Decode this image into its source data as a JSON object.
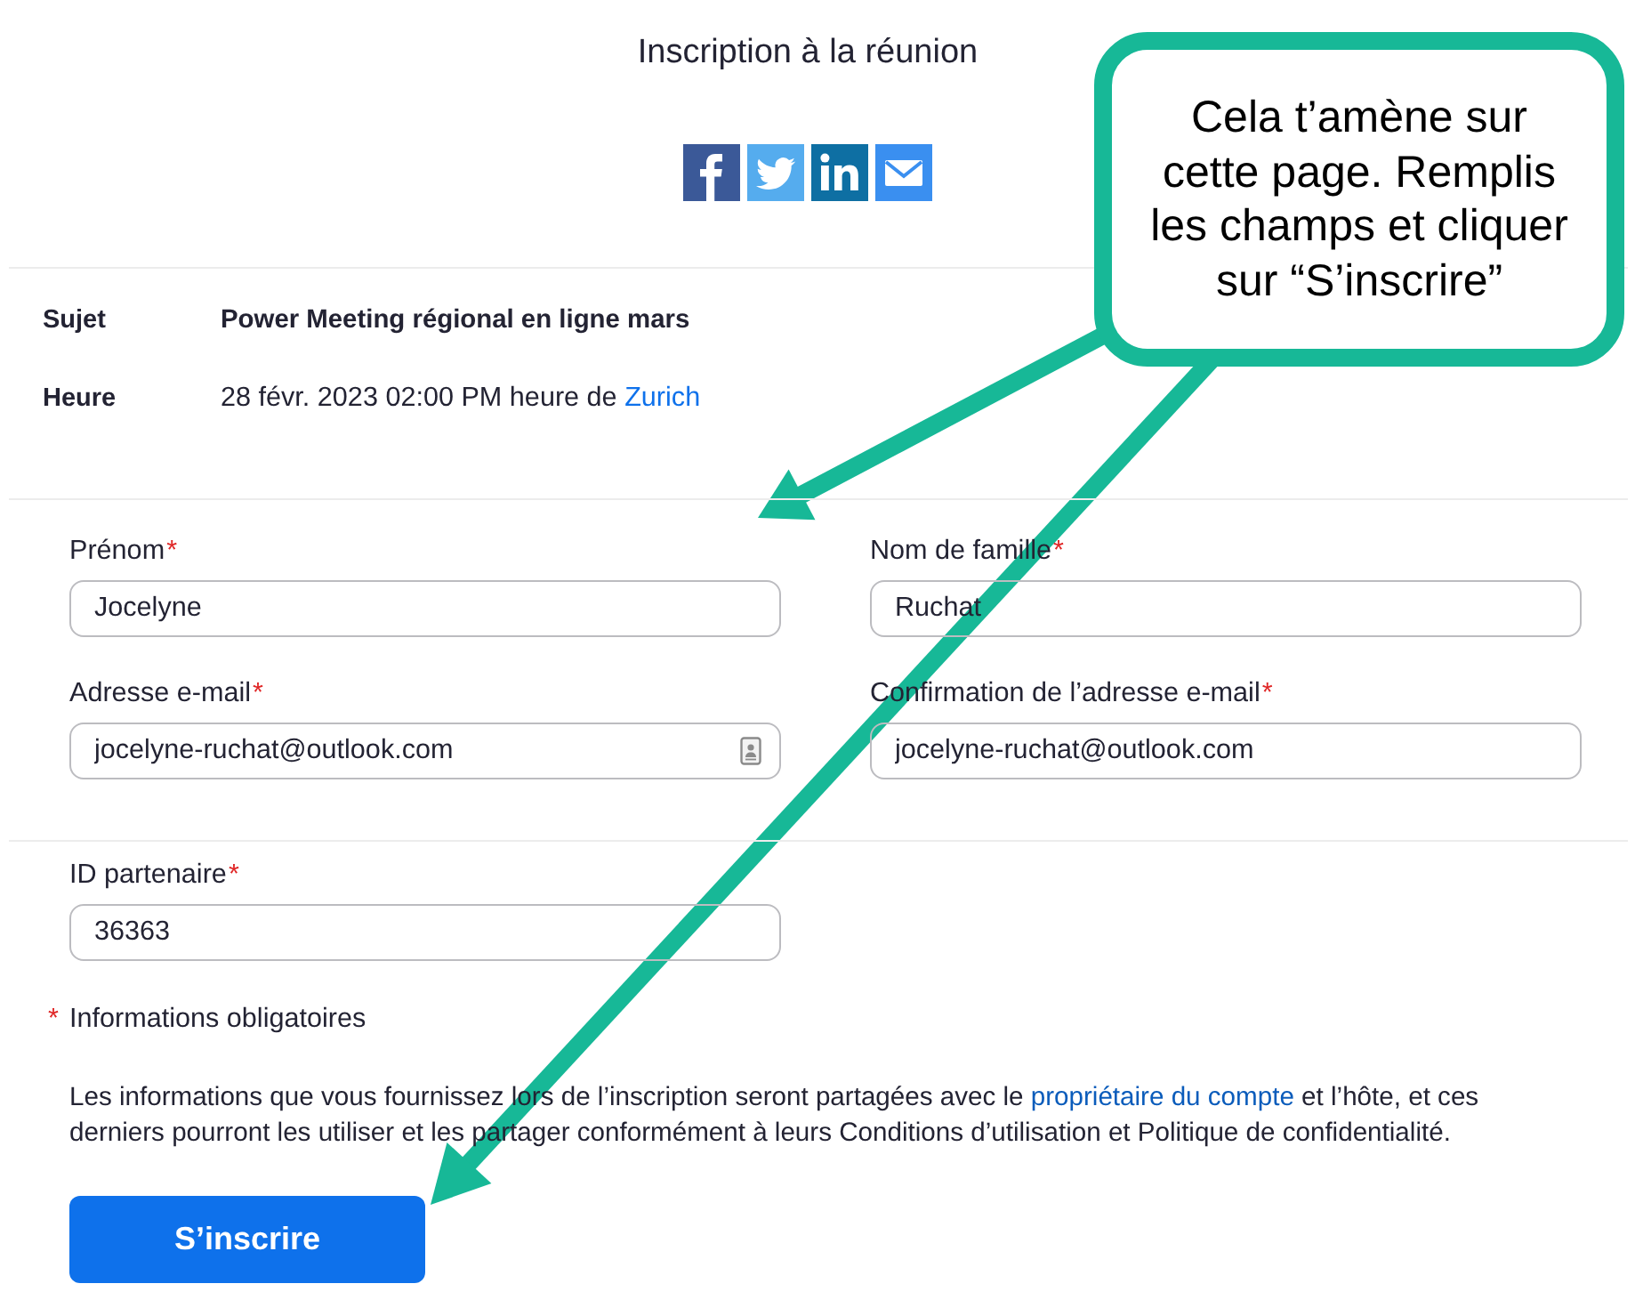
{
  "page": {
    "title": "Inscription à la réunion"
  },
  "meeting_details": [
    {
      "label": "Sujet",
      "value": "Power Meeting régional en ligne mars"
    },
    {
      "label": "Heure",
      "value": "28 févr. 2023 02:00 PM heure de ",
      "link": "Zurich"
    }
  ],
  "form_sections": [
    {
      "fields": [
        {
          "label": "Prénom",
          "mark": "*",
          "value": "Jocelyne",
          "contact_icon": false
        },
        {
          "label": "Nom de famille",
          "mark": "*",
          "value": "Ruchat",
          "contact_icon": false
        },
        {
          "label": "Adresse e-mail",
          "mark": "*",
          "value": "jocelyne-ruchat@outlook.com",
          "contact_icon": true
        },
        {
          "label": "Confirmation de l’adresse e-mail",
          "mark": "*",
          "value": "jocelyne-ruchat@outlook.com",
          "contact_icon": false
        }
      ]
    },
    {
      "fields": [
        {
          "label": "ID partenaire",
          "mark": "*",
          "value": "36363",
          "contact_icon": false
        }
      ]
    }
  ],
  "required_note": {
    "mark": "*",
    "text": "Informations obligatoires"
  },
  "disclaimer": {
    "before": "Les informations que vous fournissez lors de l’inscription seront partagées avec le ",
    "link": "propriétaire du compte",
    "after": " et l’hôte, et ces derniers pourront les utiliser et les partager conformément à leurs Conditions d’utilisation et Politique de confidentialité."
  },
  "submit_button": {
    "label": "S’inscrire"
  },
  "annotation": {
    "text": "Cela t’amène sur cette page. Remplis les champs et cliquer sur “S’inscrire”"
  }
}
